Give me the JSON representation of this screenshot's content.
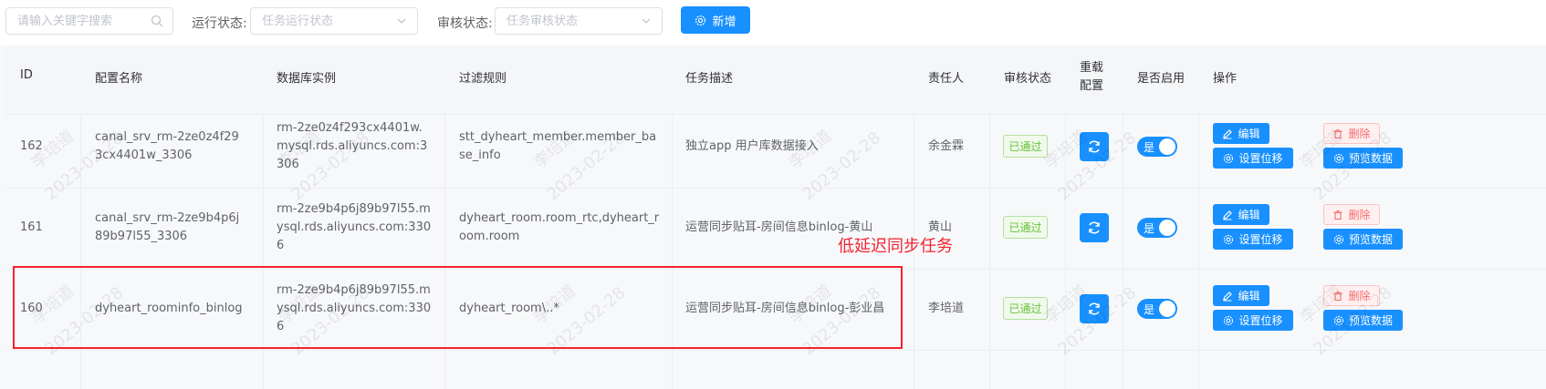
{
  "filters": {
    "search_placeholder": "请输入关键字搜索",
    "run_status_label": "运行状态:",
    "run_status_placeholder": "任务运行状态",
    "review_status_label": "审核状态:",
    "review_status_placeholder": "任务审核状态",
    "add_button": "新增"
  },
  "table": {
    "headers": {
      "id": "ID",
      "config_name": "配置名称",
      "db_instance": "数据库实例",
      "filter_rule": "过滤规则",
      "task_desc": "任务描述",
      "owner": "责任人",
      "review_status": "审核状态",
      "reload_config": "重载配置",
      "enabled": "是否启用",
      "actions": "操作"
    },
    "rows": [
      {
        "id": "162",
        "config_name": "canal_srv_rm-2ze0z4f293cx4401w_3306",
        "db_instance": "rm-2ze0z4f293cx4401w.mysql.rds.aliyuncs.com:3306",
        "filter_rule": "stt_dyheart_member.member_base_info",
        "task_desc": "独立app 用户库数据接入",
        "owner": "余金霖",
        "review_status": "已通过",
        "enabled": "是"
      },
      {
        "id": "161",
        "config_name": "canal_srv_rm-2ze9b4p6j89b97l55_3306",
        "db_instance": "rm-2ze9b4p6j89b97l55.mysql.rds.aliyuncs.com:3306",
        "filter_rule": "dyheart_room.room_rtc,dyheart_room.room",
        "task_desc": "运营同步贴耳-房间信息binlog-黄山",
        "owner": "黄山",
        "review_status": "已通过",
        "enabled": "是"
      },
      {
        "id": "160",
        "config_name": "dyheart_roominfo_binlog",
        "db_instance": "rm-2ze9b4p6j89b97l55.mysql.rds.aliyuncs.com:3306",
        "filter_rule": "dyheart_room\\..*",
        "task_desc": "运营同步贴耳-房间信息binlog-彭业昌",
        "owner": "李培道",
        "review_status": "已通过",
        "enabled": "是"
      }
    ],
    "actions": {
      "edit": "编辑",
      "delete": "删除",
      "set_offset": "设置位移",
      "preview": "预览数据"
    }
  },
  "annotation": "低延迟同步任务",
  "watermark": {
    "name": "李培道",
    "date": "2023-02-28"
  },
  "colors": {
    "primary": "#1890ff",
    "success": "#67c23a",
    "danger": "#f56c6c",
    "highlight": "#f5222d"
  }
}
